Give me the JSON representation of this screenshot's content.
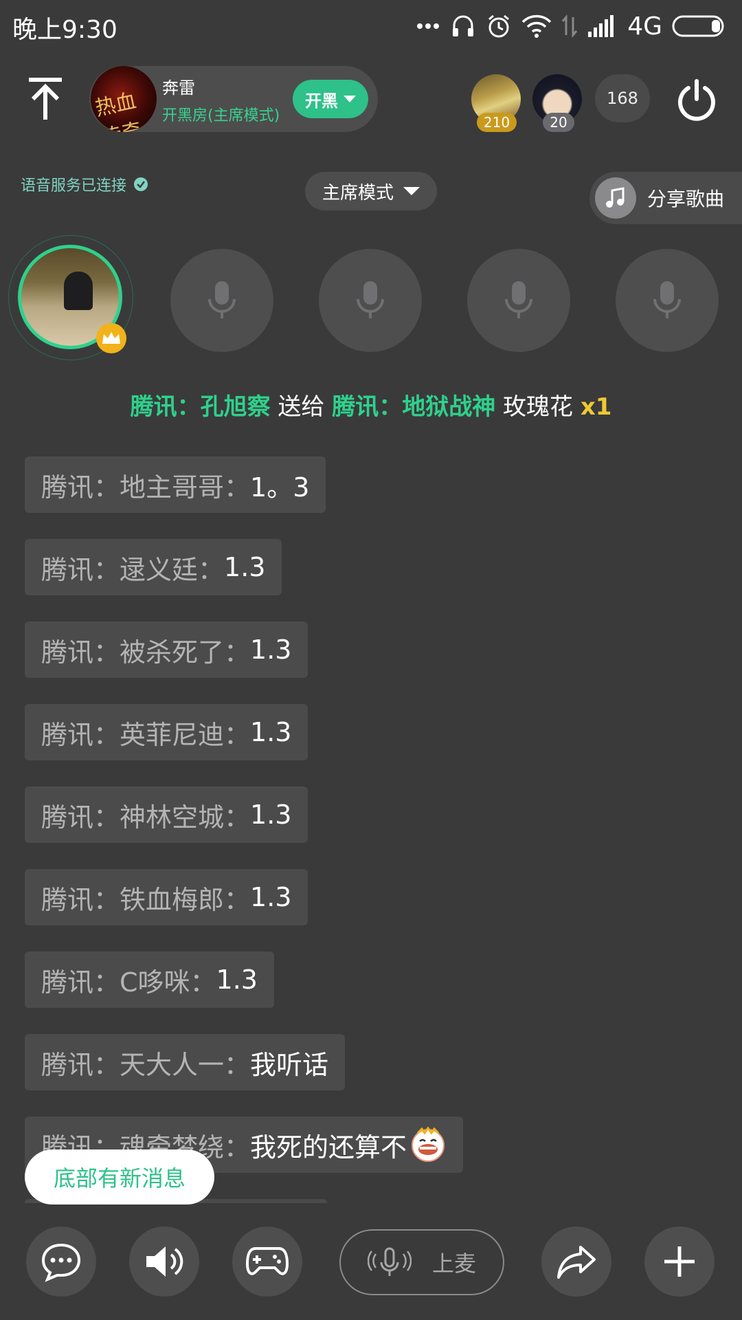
{
  "status_bar": {
    "time": "晚上9:30",
    "network": "4G"
  },
  "header": {
    "room_name": "奔雷",
    "room_mode": "开黑房(主席模式)",
    "kaihei_label": "开黑",
    "room_avatar_text": "热血传奇",
    "top_users": [
      {
        "badge": "210"
      },
      {
        "badge": "20"
      }
    ],
    "viewer_count": "168"
  },
  "voice_status": "语音服务已连接",
  "mode_select": "主席模式",
  "share_song": "分享歌曲",
  "gift": {
    "from": "腾讯：孔旭察",
    "verb": "送给",
    "to": "腾讯：地狱战神",
    "item": "玫瑰花",
    "qty": "x1"
  },
  "chat": [
    {
      "sender": "腾讯：地主哥哥：",
      "message": "1。3"
    },
    {
      "sender": "腾讯：逯义廷：",
      "message": "1.3"
    },
    {
      "sender": "腾讯：被杀死了：",
      "message": "1.3"
    },
    {
      "sender": "腾讯：英菲尼迪：",
      "message": "1.3"
    },
    {
      "sender": "腾讯：神林空城：",
      "message": "1.3"
    },
    {
      "sender": "腾讯：铁血梅郎：",
      "message": "1.3"
    },
    {
      "sender": "腾讯：C哆咪：",
      "message": "1.3"
    },
    {
      "sender": "腾讯：天大人一：",
      "message": "我听话"
    },
    {
      "sender": "腾讯：魂牵梦绕：",
      "message": "我死的还算不"
    }
  ],
  "new_message_tip": "底部有新消息",
  "bottom_bar": {
    "mic_up_label": "上麦"
  },
  "colors": {
    "background": "#3a3a3b",
    "accent_green": "#2ed18c",
    "gift_yellow": "#f0c832",
    "crown": "#f2b219"
  }
}
